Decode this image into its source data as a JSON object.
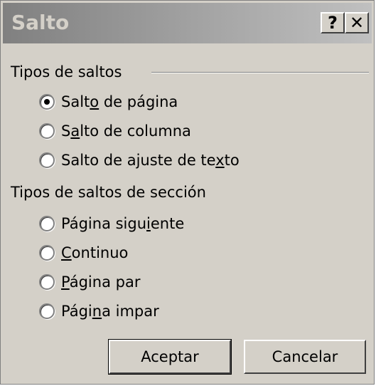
{
  "window": {
    "title": "Salto",
    "help_label": "?",
    "close_label": "✕"
  },
  "group_breaks": {
    "label": "Tipos de saltos",
    "options": [
      {
        "before": "Salt",
        "accel": "o",
        "after": " de página",
        "checked": true
      },
      {
        "before": "S",
        "accel": "a",
        "after": "lto de columna",
        "checked": false
      },
      {
        "before": "Salto de ajuste de te",
        "accel": "x",
        "after": "to",
        "checked": false
      }
    ]
  },
  "group_section": {
    "label": "Tipos de saltos de sección",
    "options": [
      {
        "before": "Página sigu",
        "accel": "i",
        "after": "ente",
        "checked": false
      },
      {
        "before": "",
        "accel": "C",
        "after": "ontinuo",
        "checked": false
      },
      {
        "before": "",
        "accel": "P",
        "after": "ágina par",
        "checked": false
      },
      {
        "before": "Pági",
        "accel": "n",
        "after": "a impar",
        "checked": false
      }
    ]
  },
  "buttons": {
    "ok_label": "Aceptar",
    "cancel_label": "Cancelar"
  }
}
